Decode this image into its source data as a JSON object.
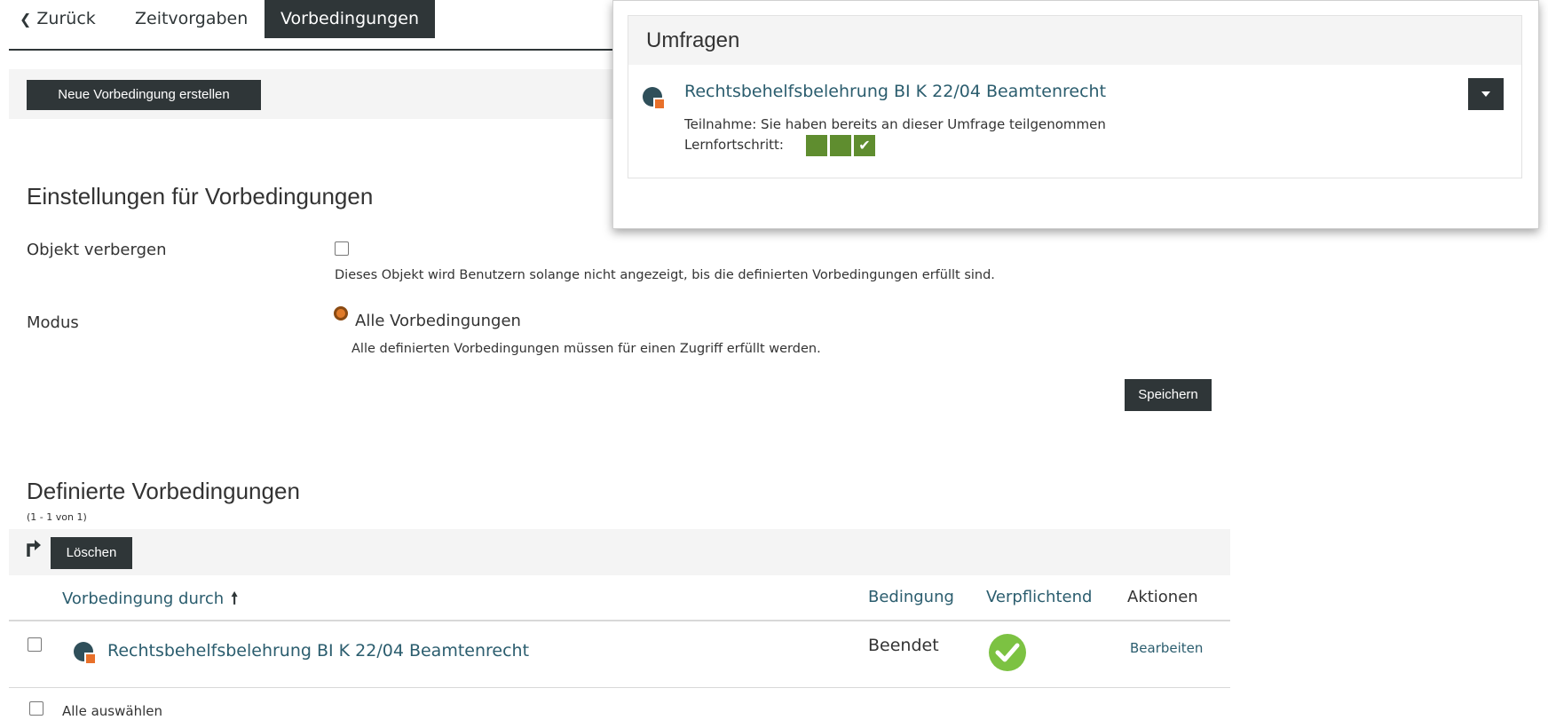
{
  "tabs": {
    "back": "Zurück",
    "zeitvorgaben": "Zeitvorgaben",
    "vorbedingungen": "Vorbedingungen"
  },
  "toolbar": {
    "new_condition": "Neue Vorbedingung erstellen"
  },
  "settings": {
    "title": "Einstellungen für Vorbedingungen",
    "hide_label": "Objekt verbergen",
    "hide_checked": false,
    "hide_description": "Dieses Objekt wird Benutzern solange nicht angezeigt, bis die definierten Vorbedingungen erfüllt sind.",
    "mode_label": "Modus",
    "mode_option": "Alle Vorbedingungen",
    "mode_description": "Alle definierten Vorbedingungen müssen für einen Zugriff erfüllt werden.",
    "save": "Speichern"
  },
  "defined": {
    "title": "Definierte Vorbedingungen",
    "count": "(1 - 1 von 1)",
    "delete": "Löschen",
    "columns": {
      "by": "Vorbedingung durch",
      "condition": "Bedingung",
      "mandatory": "Verpflichtend",
      "actions": "Aktionen"
    },
    "rows": [
      {
        "title": "Rechtsbehelfsbelehrung BI K 22/04 Beamtenrecht",
        "condition": "Beendet",
        "mandatory": true,
        "action": "Bearbeiten"
      }
    ],
    "select_all": "Alle auswählen"
  },
  "overlay": {
    "title": "Umfragen",
    "item_title": "Rechtsbehelfsbelehrung BI K 22/04 Beamtenrecht",
    "participation": "Teilnahme: Sie haben bereits an dieser Umfrage teilgenommen",
    "progress_label": "Lernfortschritt:"
  },
  "colors": {
    "dark": "#2f3638",
    "link": "#2b5d6e",
    "accent": "#e07b2a",
    "success": "#7cc242",
    "progress": "#5f8d2f"
  }
}
